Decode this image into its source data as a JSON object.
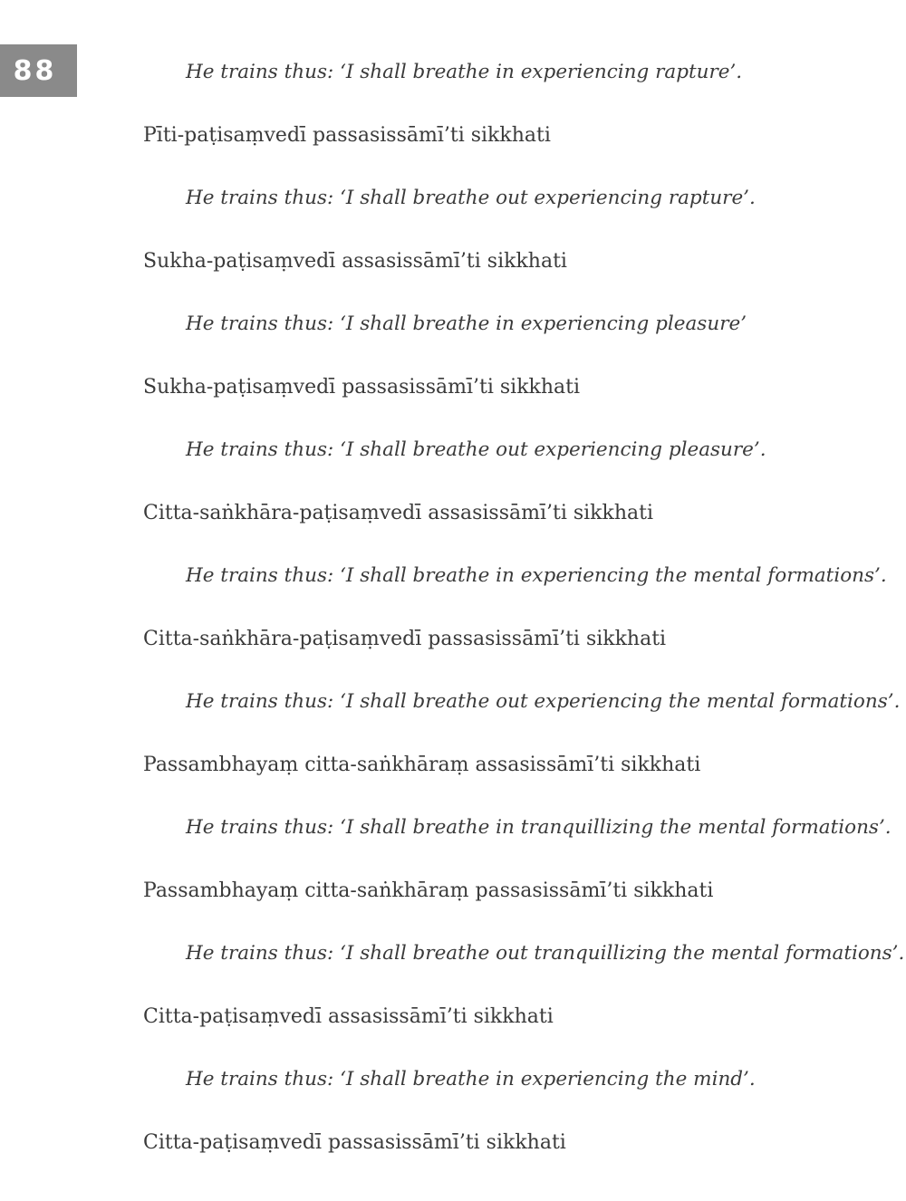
{
  "page": {
    "number": "88"
  },
  "lines": [
    {
      "kind": "english",
      "text": "He trains thus: ‘I shall breathe in experiencing rapture’."
    },
    {
      "kind": "pali",
      "text": "Pīti-paṭisaṃvedī passasissāmī’ti sikkhati"
    },
    {
      "kind": "english",
      "text": "He trains thus: ‘I shall breathe out experiencing rapture’."
    },
    {
      "kind": "pali",
      "text": "Sukha-paṭisaṃvedī assasissāmī’ti sikkhati"
    },
    {
      "kind": "english",
      "text": "He trains thus: ‘I shall breathe in experiencing pleasure’"
    },
    {
      "kind": "pali",
      "text": "Sukha-paṭisaṃvedī passasissāmī’ti sikkhati"
    },
    {
      "kind": "english",
      "text": "He trains thus: ‘I shall breathe out experiencing pleasure’."
    },
    {
      "kind": "pali",
      "text": "Citta-saṅkhāra-paṭisaṃvedī assasissāmī’ti sikkhati"
    },
    {
      "kind": "english",
      "text": "He trains thus: ‘I shall breathe in experiencing the mental formations’."
    },
    {
      "kind": "pali",
      "text": "Citta-saṅkhāra-paṭisaṃvedī passasissāmī’ti sikkhati"
    },
    {
      "kind": "english",
      "text": "He trains thus: ‘I shall breathe out experiencing the mental formations’."
    },
    {
      "kind": "pali",
      "text": "Passambhayaṃ citta-saṅkhāraṃ assasissāmī’ti sikkhati"
    },
    {
      "kind": "english",
      "text": "He trains thus: ‘I shall breathe in tranquillizing the mental formations’."
    },
    {
      "kind": "pali",
      "text": "Passambhayaṃ citta-saṅkhāraṃ passasissāmī’ti sikkhati"
    },
    {
      "kind": "english",
      "text": "He trains thus: ‘I shall breathe out tranquillizing the mental formations’."
    },
    {
      "kind": "pali",
      "text": "Citta-paṭisaṃvedī assasissāmī’ti sikkhati"
    },
    {
      "kind": "english",
      "text": "He trains thus: ‘I shall breathe in experiencing the mind’."
    },
    {
      "kind": "pali",
      "text": "Citta-paṭisaṃvedī passasissāmī’ti sikkhati"
    }
  ]
}
